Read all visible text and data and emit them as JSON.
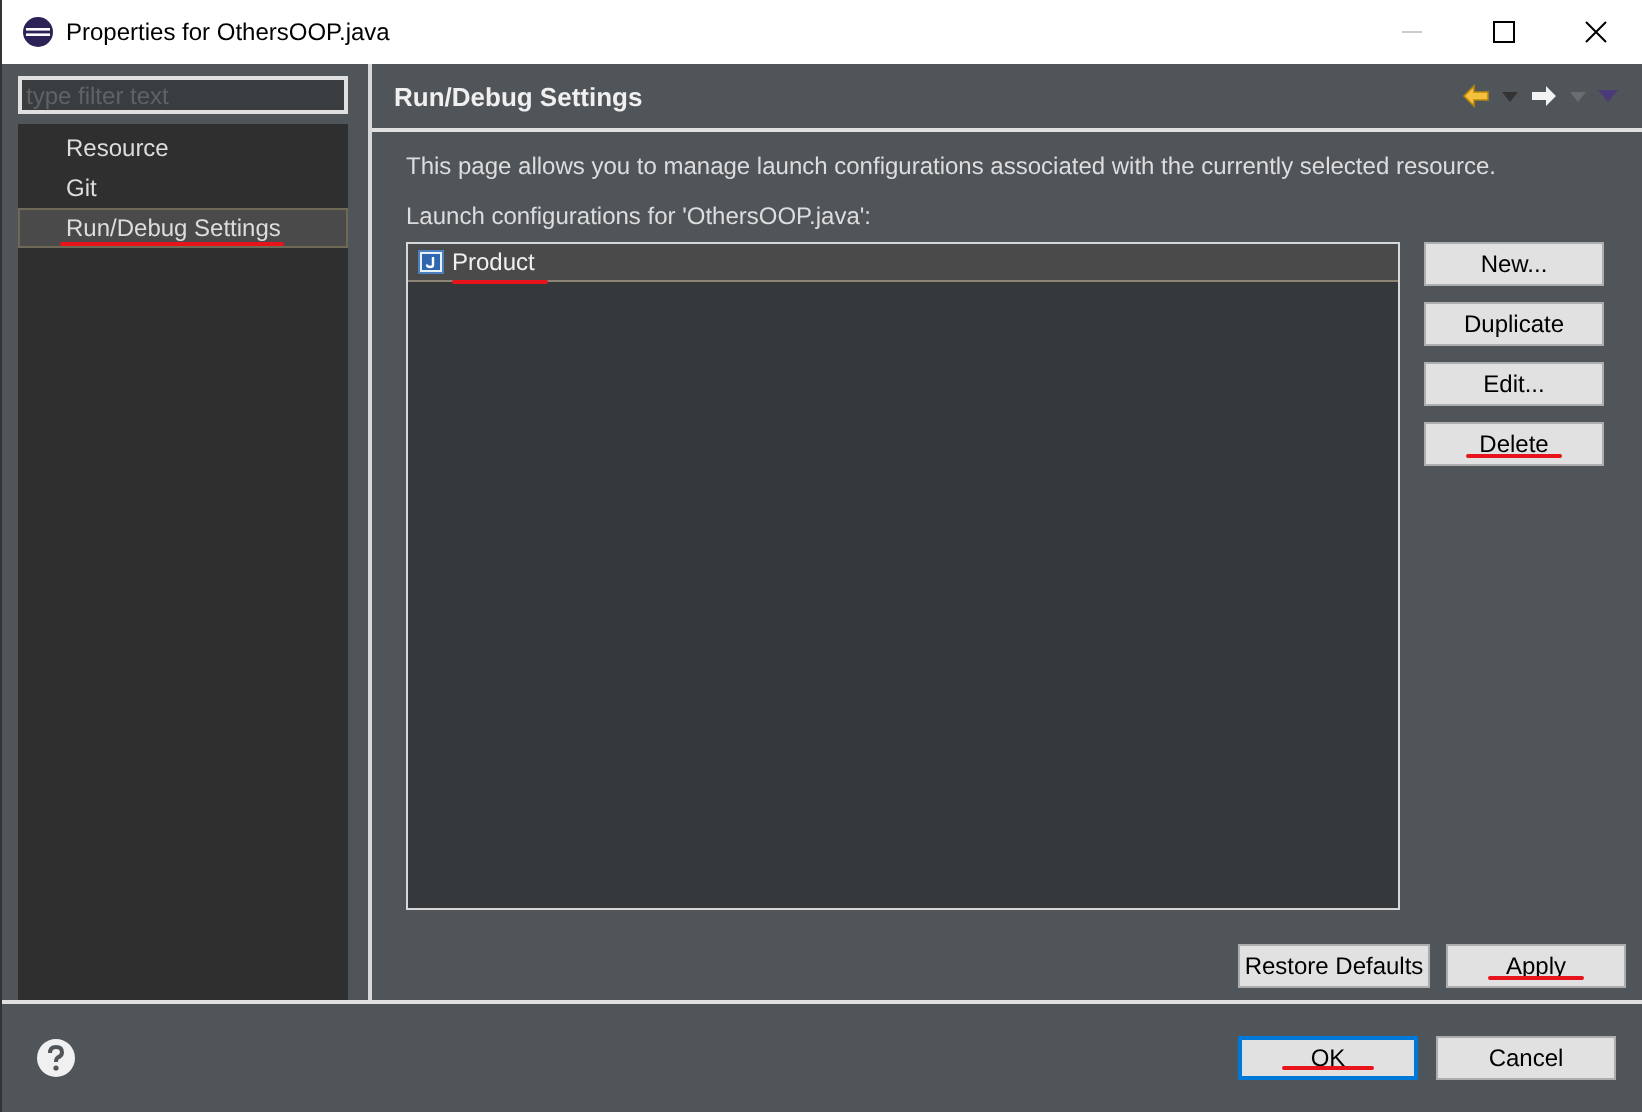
{
  "window": {
    "title": "Properties for OthersOOP.java"
  },
  "filter": {
    "placeholder": "type filter text"
  },
  "tree": [
    {
      "label": "Resource",
      "selected": false,
      "annotated": false
    },
    {
      "label": "Git",
      "selected": false,
      "annotated": false
    },
    {
      "label": "Run/Debug Settings",
      "selected": true,
      "annotated": true
    }
  ],
  "page": {
    "title": "Run/Debug Settings",
    "description": "This page allows you to manage launch configurations associated with the currently selected resource.",
    "list_label": "Launch configurations for 'OthersOOP.java':",
    "configurations": [
      {
        "label": "Product",
        "selected": true,
        "annotated": true
      }
    ],
    "side_buttons": [
      {
        "label": "New...",
        "annotated": false
      },
      {
        "label": "Duplicate",
        "annotated": false
      },
      {
        "label": "Edit...",
        "annotated": false
      },
      {
        "label": "Delete",
        "annotated": true
      }
    ],
    "page_buttons": [
      {
        "label": "Restore Defaults",
        "annotated": false
      },
      {
        "label": "Apply",
        "annotated": true
      }
    ]
  },
  "dialog_buttons": [
    {
      "label": "OK",
      "default": true,
      "annotated": true
    },
    {
      "label": "Cancel",
      "default": false,
      "annotated": false
    }
  ]
}
